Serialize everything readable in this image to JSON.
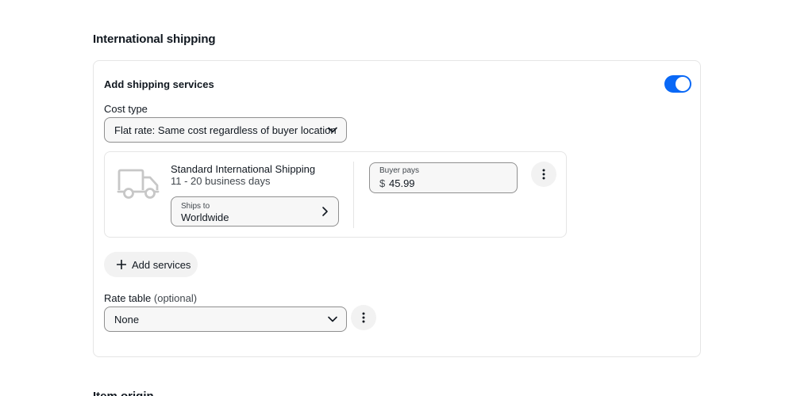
{
  "section": {
    "title": "International shipping",
    "next_title": "Item origin"
  },
  "card": {
    "add_label": "Add shipping services",
    "toggle_on": true,
    "accent_color": "#0968f6",
    "cost_type_label": "Cost type",
    "cost_type_value": "Flat rate: Same cost regardless of buyer location",
    "service": {
      "icon": "truck-icon",
      "name": "Standard International Shipping",
      "days": "11 - 20 business days",
      "ships_to_label": "Ships to",
      "ships_to_value": "Worldwide",
      "buyer_pays_label": "Buyer pays",
      "currency": "$",
      "buyer_pays_value": "45.99"
    },
    "add_services_label": "Add services",
    "rate_table_label": "Rate table",
    "rate_table_optional": "(optional)",
    "rate_table_value": "None"
  }
}
